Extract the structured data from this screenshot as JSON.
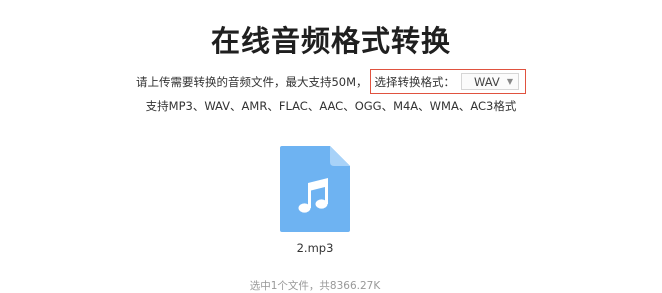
{
  "page": {
    "title": "在线音频格式转换"
  },
  "upload": {
    "instruction": "请上传需要转换的音频文件，最大支持50M，",
    "format_label": "选择转换格式：",
    "format_selected": "WAV",
    "supported_formats": "支持MP3、WAV、AMR、FLAC、AAC、OGG、M4A、WMA、AC3格式"
  },
  "file": {
    "icon": "music-file-icon",
    "name": "2.mp3",
    "selected_info": "选中1个文件，共8366.27K"
  },
  "colors": {
    "highlight_border": "#e0523f",
    "file_icon": "#6eb3f2",
    "file_icon_fold": "#a8d2f8"
  }
}
